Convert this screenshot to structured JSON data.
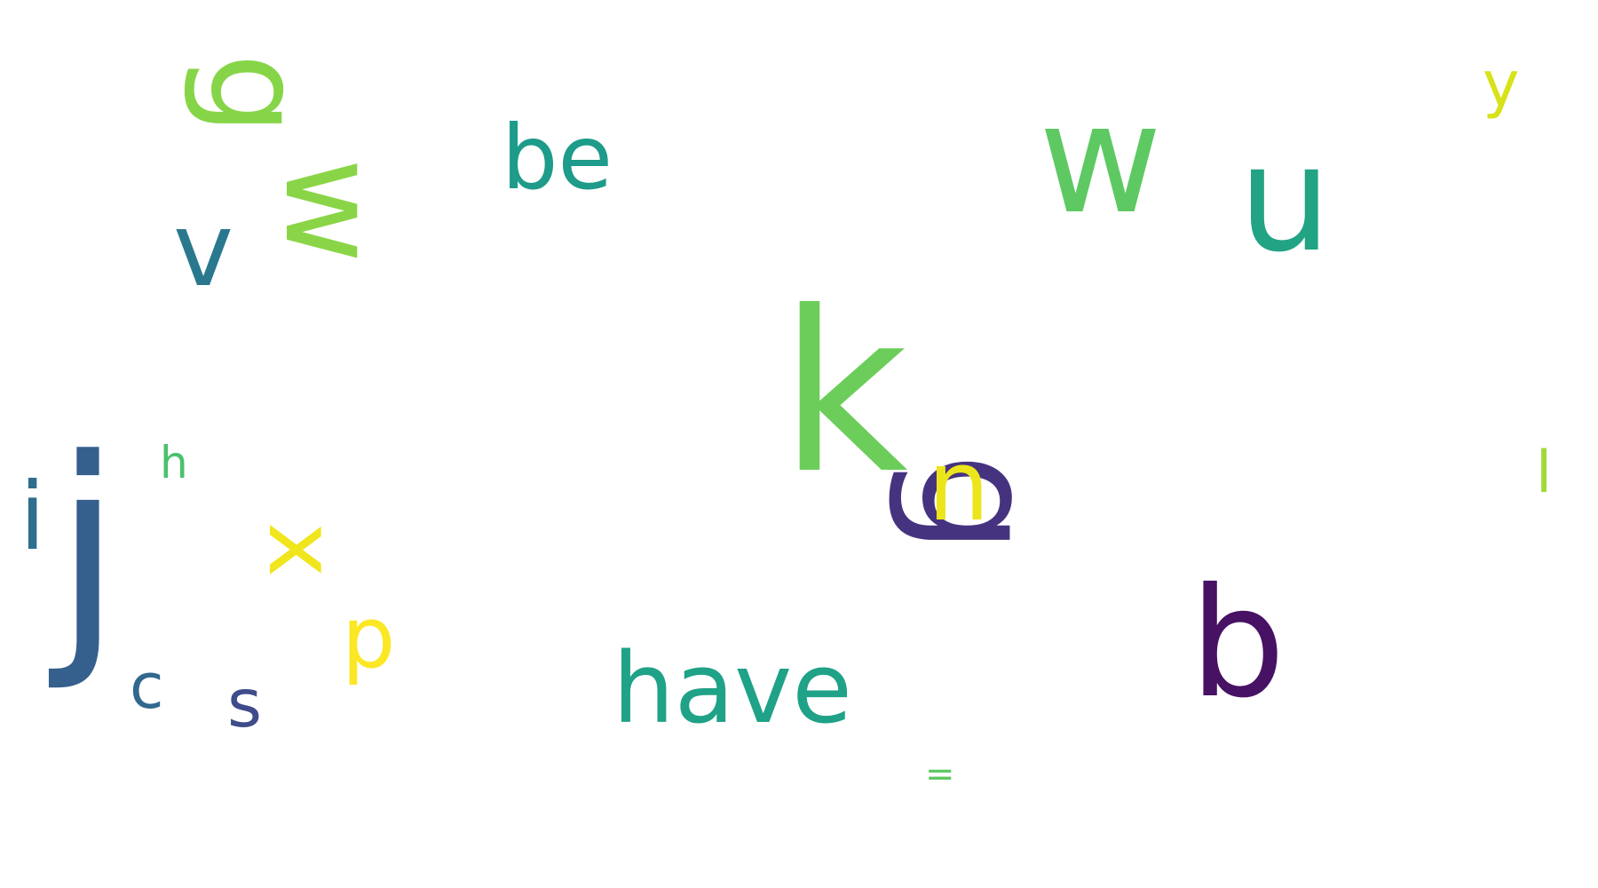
{
  "words": [
    {
      "text": "k",
      "color": "#6ccd5a"
    },
    {
      "text": "b",
      "color": "#471164"
    },
    {
      "text": "u",
      "color": "#22a384"
    },
    {
      "text": "j",
      "color": "#355f8d"
    },
    {
      "text": "w",
      "color": "#5ec962"
    },
    {
      "text": "g",
      "color": "#46337f"
    },
    {
      "text": "g",
      "color": "#86d549"
    },
    {
      "text": "w",
      "color": "#8ad547"
    },
    {
      "text": "have",
      "color": "#1fa287"
    },
    {
      "text": "n",
      "color": "#ece51b"
    },
    {
      "text": "be",
      "color": "#1e9b8a"
    },
    {
      "text": "v",
      "color": "#2a788e"
    },
    {
      "text": "x",
      "color": "#f1e51d"
    },
    {
      "text": "p",
      "color": "#fbe723"
    },
    {
      "text": "i",
      "color": "#2e6f8e"
    },
    {
      "text": "s",
      "color": "#3e4c8a"
    },
    {
      "text": "c",
      "color": "#31688e"
    },
    {
      "text": "y",
      "color": "#d8e219"
    },
    {
      "text": "l",
      "color": "#a0da39"
    },
    {
      "text": "h",
      "color": "#4ac16d"
    },
    {
      "text": "=",
      "color": "#5ec962"
    }
  ]
}
